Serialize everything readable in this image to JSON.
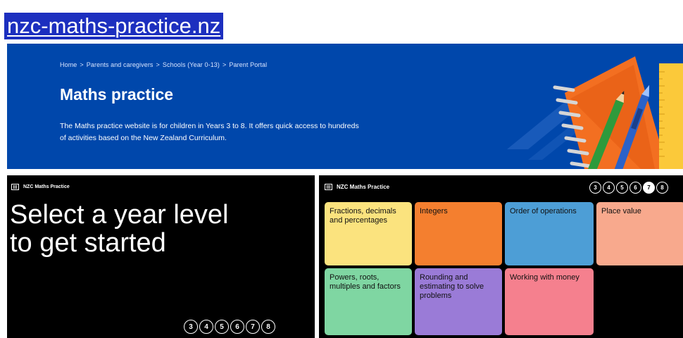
{
  "site": {
    "url": "nzc-maths-practice.nz"
  },
  "hero": {
    "breadcrumbs": [
      "Home",
      "Parents and caregivers",
      "Schools (Year 0-13)",
      "Parent Portal"
    ],
    "separator": ">",
    "title": "Maths practice",
    "description": "The Maths practice website is for children in Years 3 to 8. It offers quick access to hundreds of activities based on the New Zealand Curriculum.",
    "background_color": "#0047ab"
  },
  "left_panel": {
    "brand": "NZC Maths Practice",
    "heading_line1": "Select a year level",
    "heading_line2": "to get started",
    "years": [
      "3",
      "4",
      "5",
      "6",
      "7",
      "8"
    ]
  },
  "right_panel": {
    "brand": "NZC Maths Practice",
    "years": [
      "3",
      "4",
      "5",
      "6",
      "7",
      "8"
    ],
    "selected_year": "7",
    "topics": [
      {
        "label": "Fractions, decimals and percentages",
        "color": "#fbe37e"
      },
      {
        "label": "Integers",
        "color": "#f47f2f"
      },
      {
        "label": "Order of operations",
        "color": "#4d9ed6"
      },
      {
        "label": "Place value",
        "color": "#f8a98d"
      },
      {
        "label": "Powers, roots, multiples and factors",
        "color": "#7fd6a2"
      },
      {
        "label": "Rounding and estimating to solve problems",
        "color": "#9a7bd7"
      },
      {
        "label": "Working with money",
        "color": "#f5808e"
      }
    ]
  }
}
